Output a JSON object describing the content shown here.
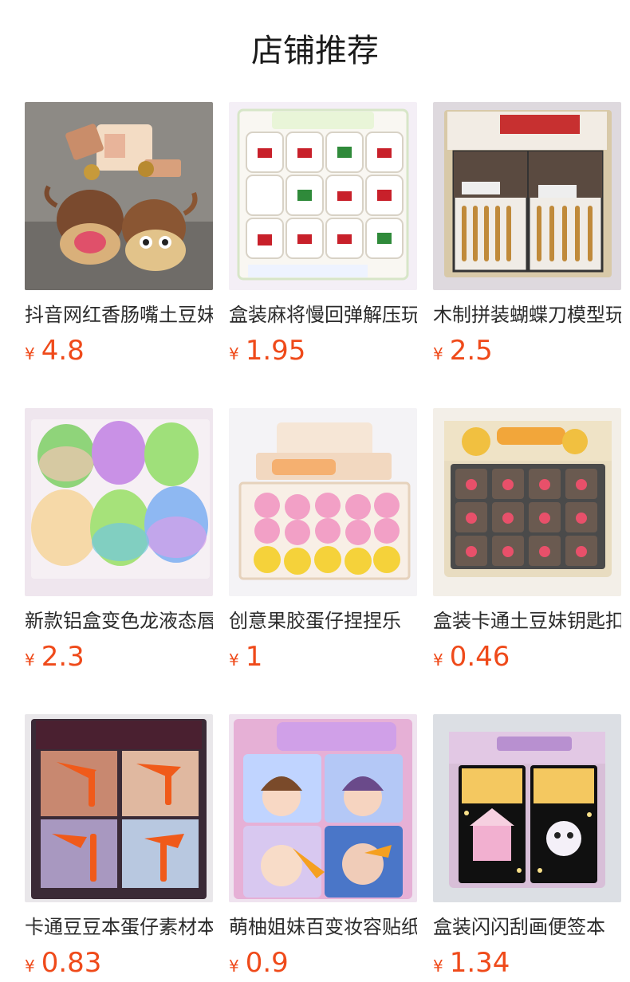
{
  "header": {
    "title": "店铺推荐"
  },
  "products": [
    {
      "name": "抖音网红香肠嘴土豆妹钥匙扣",
      "currency": "¥",
      "price": "4.8",
      "image": "keychain-potato-photo"
    },
    {
      "name": "盒装麻将慢回弹解压玩具",
      "currency": "¥",
      "price": "1.95",
      "image": "mahjong-squishy-photo"
    },
    {
      "name": "木制拼装蝴蝶刀模型玩具",
      "currency": "¥",
      "price": "2.5",
      "image": "wooden-knife-model-photo"
    },
    {
      "name": "新款铝盒变色龙液态唇泥",
      "currency": "¥",
      "price": "2.3",
      "image": "color-tin-box-photo"
    },
    {
      "name": "创意果胶蛋仔捏捏乐",
      "currency": "¥",
      "price": "1",
      "image": "jelly-squishy-photo"
    },
    {
      "name": "盒装卡通土豆妹钥匙扣",
      "currency": "¥",
      "price": "0.46",
      "image": "potato-girl-box-photo"
    },
    {
      "name": "卡通豆豆本蛋仔素材本",
      "currency": "¥",
      "price": "0.83",
      "image": "cartoon-notebook-photo"
    },
    {
      "name": "萌柚姐妹百变妆容贴纸书",
      "currency": "¥",
      "price": "0.9",
      "image": "sticker-book-photo"
    },
    {
      "name": "盒装闪闪刮画便签本",
      "currency": "¥",
      "price": "1.34",
      "image": "scratch-notepad-photo"
    }
  ]
}
